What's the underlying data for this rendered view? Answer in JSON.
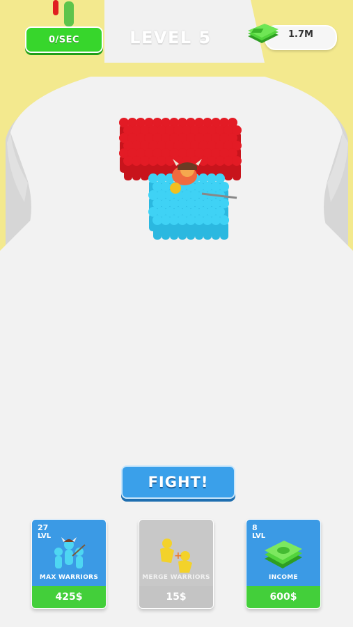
{
  "hud": {
    "income_rate": "0/SEC",
    "level": "LEVEL 5",
    "money": "1.7M",
    "money_icon": "cash-stack-icon"
  },
  "fight_button": {
    "label": "FIGHT!"
  },
  "upgrades": [
    {
      "title": "MAX WARRIORS",
      "level": "27",
      "level_label": "LVL",
      "price": "425$",
      "icon": "warriors-icon",
      "enabled": true
    },
    {
      "title": "MERGE WARRIORS",
      "price": "15$",
      "icon": "merge-icon",
      "enabled": false
    },
    {
      "title": "INCOME",
      "level": "8",
      "level_label": "LVL",
      "price": "600$",
      "icon": "cash-stack-icon",
      "enabled": true
    }
  ],
  "colors": {
    "enemy_army": "#e31b25",
    "player_army": "#3fd2f5",
    "accent_green": "#37d62c",
    "accent_blue": "#3aa0ea",
    "background": "#f3e98e",
    "track": "#f0f0f0"
  }
}
